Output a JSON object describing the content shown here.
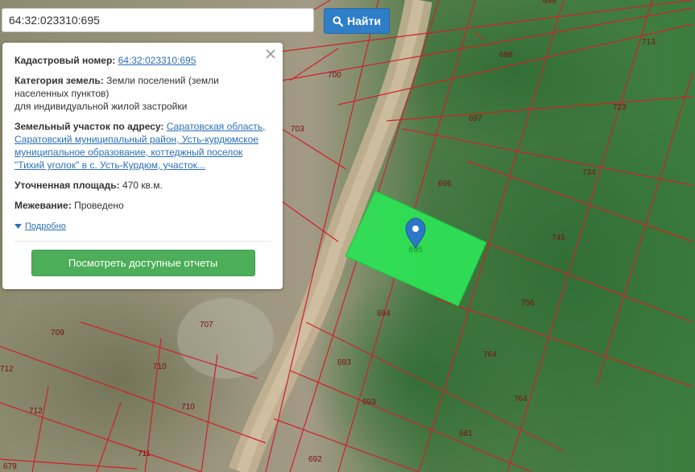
{
  "search": {
    "value": "64:32:023310:695",
    "button_label": "Найти"
  },
  "panel": {
    "cadastral_label": "Кадастровый номер:",
    "cadastral_value": "64:32:023310:695",
    "category_label": "Категория земель:",
    "category_line1": "Земли поселений (земли",
    "category_line2": "населенных пунктов)",
    "category_line3": "для индивидуальной жилой застройки",
    "address_label": "Земельный участок по адресу:",
    "address_line1": "Саратовская область,",
    "address_line2": "Саратовский муниципальный район, Усть-курдюмское",
    "address_line3": "муниципальное образование, коттеджный поселок",
    "address_line4": "\"Тихий уголок\" в с. Усть-Курдюм, участок...",
    "area_label": "Уточненная площадь:",
    "area_value": "470 кв.м.",
    "survey_label": "Межевание:",
    "survey_value": "Проведено",
    "more_label": "Подробно",
    "report_button_label": "Посмотреть доступные отчеты"
  },
  "map": {
    "selected_parcel_label": "695",
    "parcel_labels": [
      "699",
      "698",
      "713",
      "700",
      "723",
      "703",
      "697",
      "734",
      "696",
      "745",
      "756",
      "694",
      "707",
      "709",
      "693",
      "764",
      "712",
      "710",
      "693",
      "764",
      "710",
      "712",
      "681",
      "711",
      "692",
      "679"
    ],
    "colors": {
      "selected_fill": "#2ee055",
      "boundary": "#d0202a",
      "marker": "#2c78c8",
      "label_text": "#7a1010"
    },
    "icons": [
      "location-pin-icon",
      "search-icon",
      "close-icon",
      "caret-down-icon"
    ]
  }
}
